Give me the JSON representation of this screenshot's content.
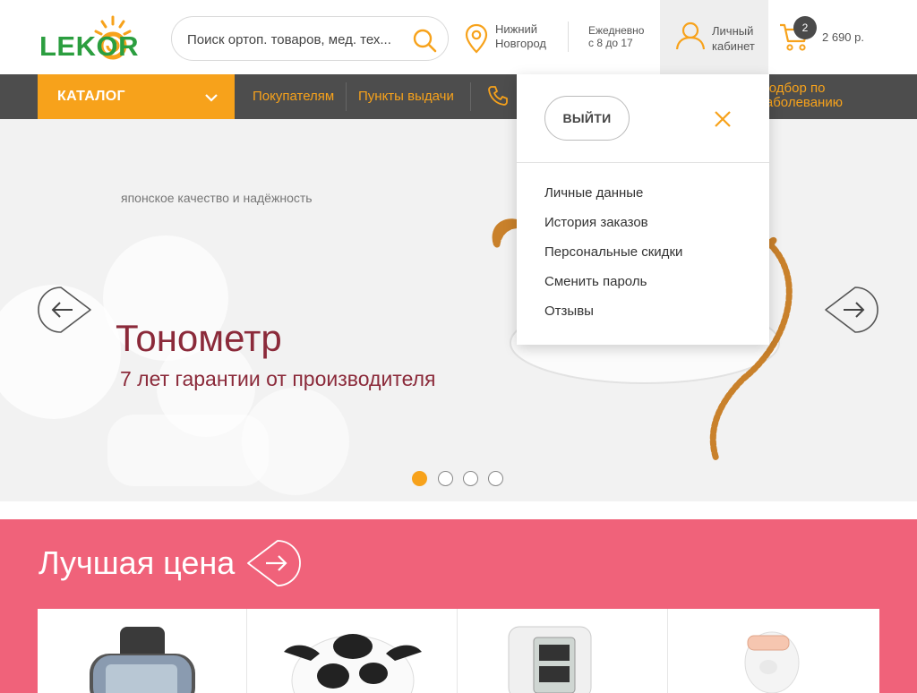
{
  "logo": {
    "text": "LEKOR"
  },
  "search": {
    "placeholder": "Поиск ортоп. товаров, мед. тех..."
  },
  "location": {
    "line1": "Нижний",
    "line2": "Новгород"
  },
  "hours": {
    "line1": "Ежедневно",
    "line2": "с 8 до 17"
  },
  "account": {
    "line1": "Личный",
    "line2": "кабинет"
  },
  "cart": {
    "count": "2",
    "total": "2 690 р."
  },
  "nav": {
    "catalog": "КАТАЛОГ",
    "links": [
      "Покупателям",
      "Пункты выдачи"
    ],
    "selection_line1": "Подбор по",
    "selection_line2": "заболеванию"
  },
  "slide": {
    "tagline": "японское качество и надёжность",
    "title": "Тонометр",
    "subtitle": "7 лет гарантии от производителя",
    "total_slides": 4,
    "active_slide": 1
  },
  "dropdown": {
    "logout": "ВЫЙТИ",
    "items": [
      "Личные данные",
      "История заказов",
      "Персональные скидки",
      "Сменить пароль",
      "Отзывы"
    ]
  },
  "best_price": {
    "title": "Лучшая цена"
  },
  "colors": {
    "accent": "#f7a21b",
    "nav_bg": "#4d4d4d",
    "brand_green": "#2b9e3f",
    "best_bg": "#f0627a",
    "slide_text": "#8b2a3a"
  },
  "icons": [
    "sun-logo-icon",
    "search-icon",
    "map-pin-icon",
    "user-icon",
    "cart-icon",
    "chevron-down-icon",
    "phone-icon",
    "arrow-left-icon",
    "arrow-right-icon",
    "close-icon"
  ]
}
